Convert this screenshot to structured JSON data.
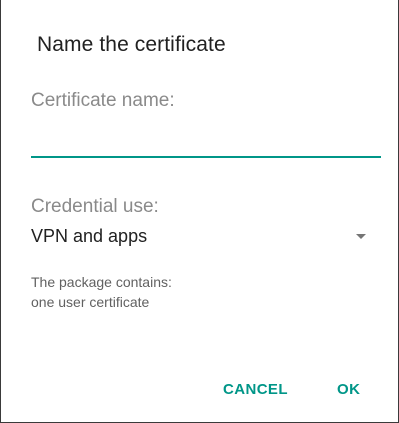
{
  "dialog": {
    "title": "Name the certificate",
    "certificate_name": {
      "label": "Certificate name:",
      "value": "",
      "placeholder": ""
    },
    "credential_use": {
      "label": "Credential use:",
      "selected": "VPN and apps"
    },
    "info": {
      "line1": "The package contains:",
      "line2": "one user certificate"
    },
    "buttons": {
      "cancel": "CANCEL",
      "ok": "OK"
    }
  },
  "colors": {
    "accent": "#009688",
    "label_gray": "#8a8a8a",
    "text": "#212121"
  }
}
